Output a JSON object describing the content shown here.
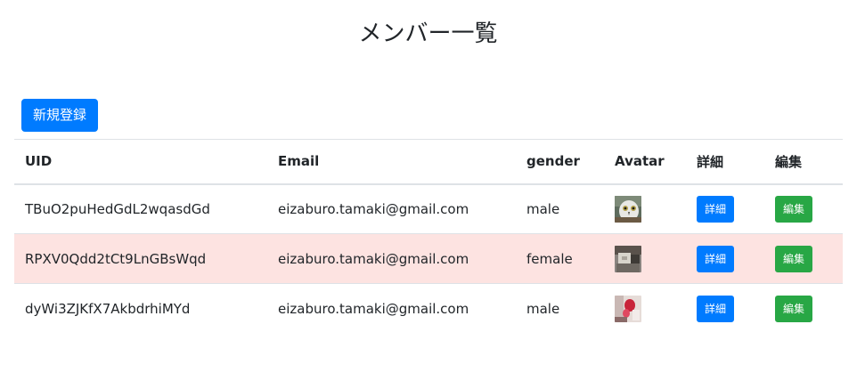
{
  "page": {
    "title": "メンバー一覧"
  },
  "toolbar": {
    "new_label": "新規登録"
  },
  "table": {
    "headers": {
      "uid": "UID",
      "email": "Email",
      "gender": "gender",
      "avatar": "Avatar",
      "detail": "詳細",
      "edit": "編集"
    },
    "rows": [
      {
        "uid": "TBuO2puHedGdL2wqasdGd",
        "email": "eizaburo.tamaki@gmail.com",
        "gender": "male",
        "highlighted": false,
        "detail_label": "詳細",
        "edit_label": "編集"
      },
      {
        "uid": "RPXV0Qdd2tCt9LnGBsWqd",
        "email": "eizaburo.tamaki@gmail.com",
        "gender": "female",
        "highlighted": true,
        "detail_label": "詳細",
        "edit_label": "編集"
      },
      {
        "uid": "dyWi3ZJKfX7AkbdrhiMYd",
        "email": "eizaburo.tamaki@gmail.com",
        "gender": "male",
        "highlighted": false,
        "detail_label": "詳細",
        "edit_label": "編集"
      }
    ]
  },
  "colors": {
    "primary": "#007bff",
    "success": "#28a745",
    "highlight_row": "#fde3e1",
    "border": "#dee2e6"
  }
}
